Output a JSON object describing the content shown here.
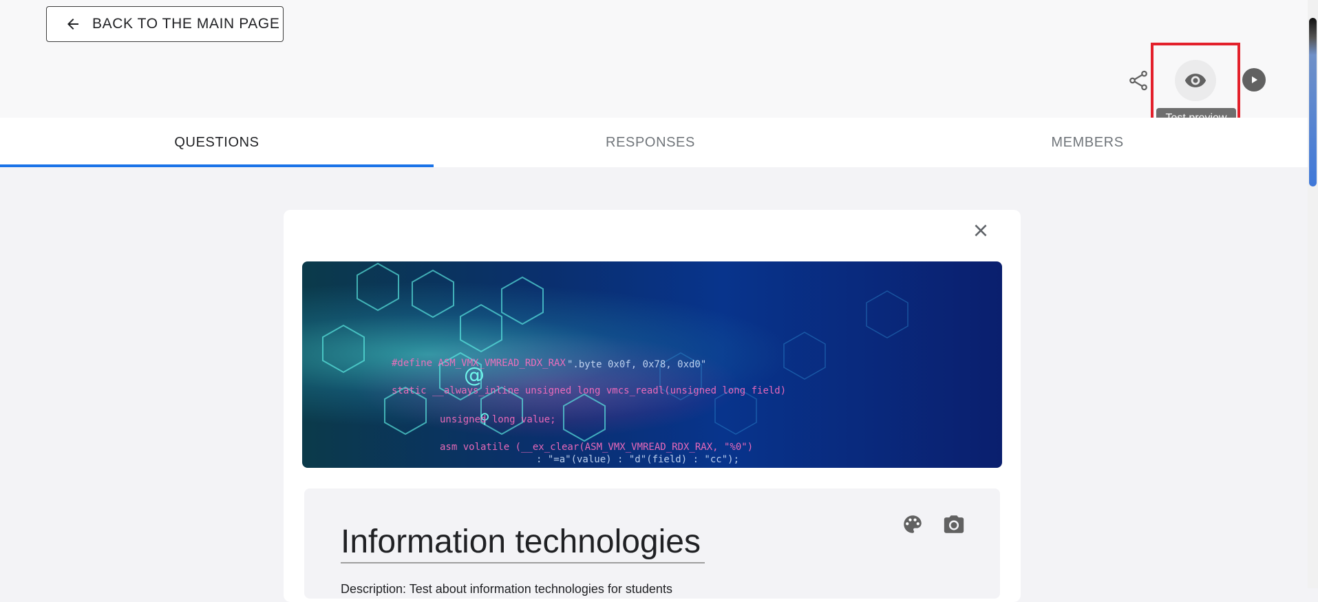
{
  "header": {
    "back_label": "BACK TO THE MAIN PAGE",
    "tooltip": "Test preview",
    "icons": [
      "arrow-left-icon",
      "share-icon",
      "eye-icon",
      "play-icon"
    ]
  },
  "tabs": [
    {
      "label": "QUESTIONS",
      "active": true
    },
    {
      "label": "RESPONSES",
      "active": false
    },
    {
      "label": "MEMBERS",
      "active": false
    }
  ],
  "banner": {
    "code_lines": [
      "#define ASM_VMX_VMREAD_RDX_RAX",
      "\".byte 0x0f, 0x78, 0xd0\"",
      "static __always_inline unsigned long vmcs_readl(unsigned long field)",
      "unsigned long value;",
      "asm volatile (__ex_clear(ASM_VMX_VMREAD_RDX_RAX, \"%0\")",
      ": \"=a\"(value) : \"d\"(field) : \"cc\");"
    ]
  },
  "form": {
    "title": "Information technologies",
    "description": "Description: Test about information technologies for students"
  },
  "colors": {
    "accent": "#1a73e8",
    "highlight": "#e3202b",
    "tooltip_bg": "#6e6e6e"
  }
}
